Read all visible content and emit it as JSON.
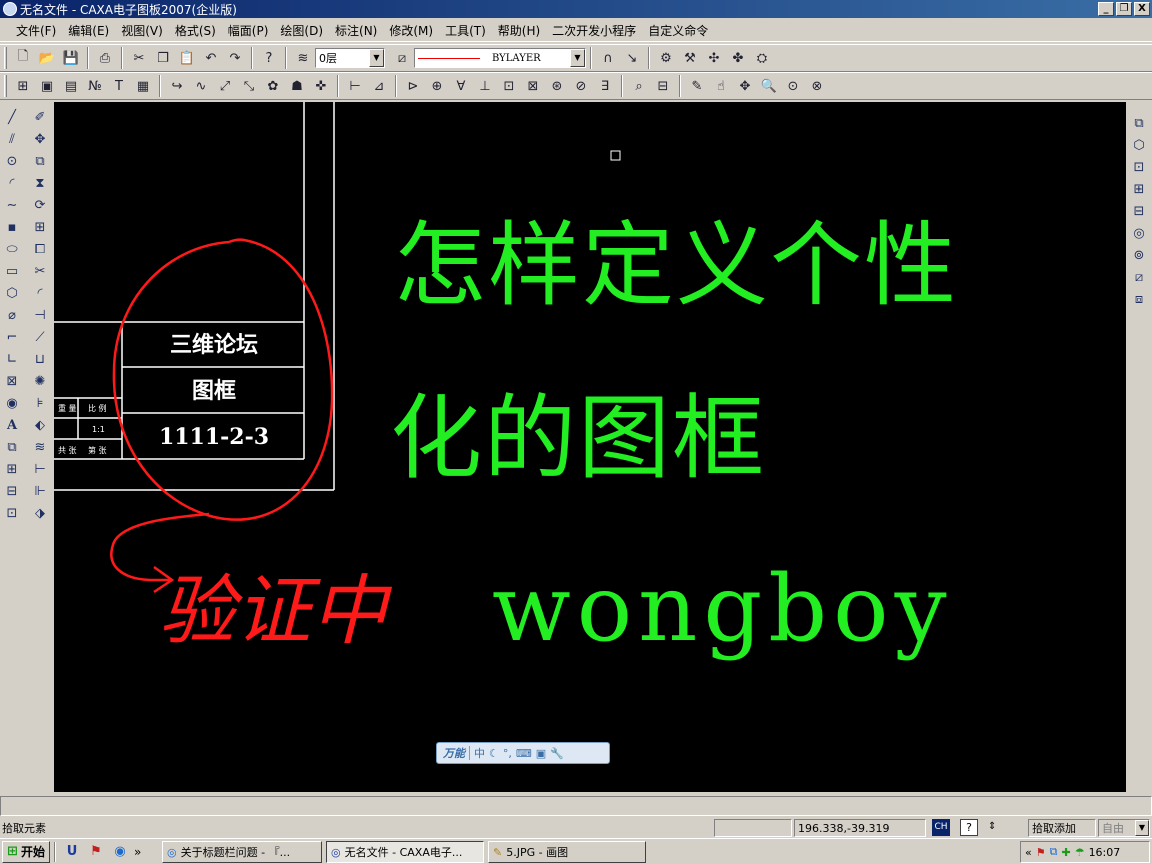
{
  "window": {
    "title": "无名文件 - CAXA电子图板2007(企业版)",
    "controls": [
      "_",
      "❐",
      "X"
    ]
  },
  "menu": [
    "文件(F)",
    "编辑(E)",
    "视图(V)",
    "格式(S)",
    "幅面(P)",
    "绘图(D)",
    "标注(N)",
    "修改(M)",
    "工具(T)",
    "帮助(H)",
    "二次开发小程序",
    "自定义命令"
  ],
  "toolbar": {
    "layer_value": "0层",
    "linetype_value": "BYLAYER"
  },
  "drawing": {
    "title_block": {
      "name": "三维论坛",
      "subtitle": "图框",
      "code": "1111-2-3",
      "small_labels": [
        "重 量",
        "比 例",
        "1:1",
        "共 张",
        "第 张"
      ]
    },
    "headline_line1": "怎样定义个性",
    "headline_line2": "化的图框",
    "author": "wongboy",
    "annotation": "验证中",
    "colors": {
      "headline": "#22ee22",
      "annotation": "#ff1a1a",
      "block_lines": "#ffffff",
      "background": "#000000"
    }
  },
  "ime": {
    "label": "万能",
    "mode": "中"
  },
  "status": {
    "command": "拾取元素",
    "coordinates": "196.338,-39.319",
    "ch": "CH",
    "mode": "拾取添加",
    "snap": "自由"
  },
  "taskbar": {
    "start": "开始",
    "chevron": "»",
    "tasks": [
      "关于标题栏问题 - 『...",
      "无名文件 - CAXA电子...",
      "5.JPG - 画图"
    ],
    "tray_chevron": "«",
    "time": "16:07"
  }
}
